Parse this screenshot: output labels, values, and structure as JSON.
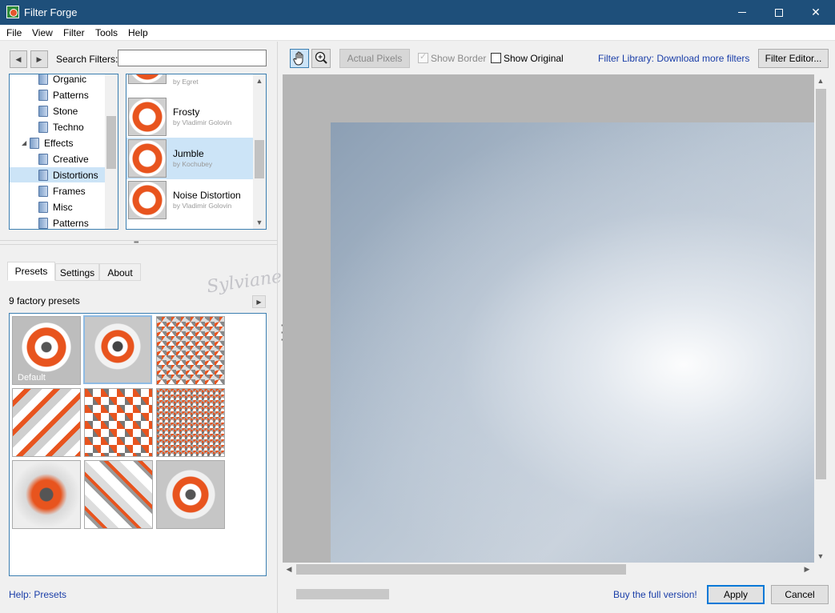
{
  "window": {
    "title": "Filter Forge"
  },
  "menu": [
    "File",
    "View",
    "Filter",
    "Tools",
    "Help"
  ],
  "search": {
    "label": "Search Filters:",
    "value": ""
  },
  "tree": {
    "items": [
      {
        "label": "Organic",
        "level": 2
      },
      {
        "label": "Patterns",
        "level": 2
      },
      {
        "label": "Stone",
        "level": 2
      },
      {
        "label": "Techno",
        "level": 2
      },
      {
        "label": "Effects",
        "level": 1,
        "expanded": true
      },
      {
        "label": "Creative",
        "level": 2
      },
      {
        "label": "Distortions",
        "level": 2,
        "selected": true
      },
      {
        "label": "Frames",
        "level": 2
      },
      {
        "label": "Misc",
        "level": 2
      },
      {
        "label": "Patterns",
        "level": 2
      }
    ]
  },
  "filters": [
    {
      "name": "",
      "author": "by Egret"
    },
    {
      "name": "Frosty",
      "author": "by Vladimir Golovin"
    },
    {
      "name": "Jumble",
      "author": "by Kochubey",
      "selected": true
    },
    {
      "name": "Noise Distortion",
      "author": "by Vladimir Golovin"
    }
  ],
  "tabs": [
    "Presets",
    "Settings",
    "About"
  ],
  "presets": {
    "count_label": "9 factory presets",
    "default_label": "Default",
    "total": 9
  },
  "help_link": "Help: Presets",
  "toolbar": {
    "actual_pixels": "Actual Pixels",
    "show_border": "Show Border",
    "show_original": "Show Original",
    "library_link": "Filter Library: Download more filters",
    "editor_button": "Filter Editor..."
  },
  "footer": {
    "buy_link": "Buy the full version!",
    "apply": "Apply",
    "cancel": "Cancel"
  },
  "watermark": "Sylviane",
  "colors": {
    "titlebar": "#1e4f7a",
    "selection": "#cce4f7",
    "link": "#1a3ea8",
    "accent_orange": "#e8541e"
  }
}
